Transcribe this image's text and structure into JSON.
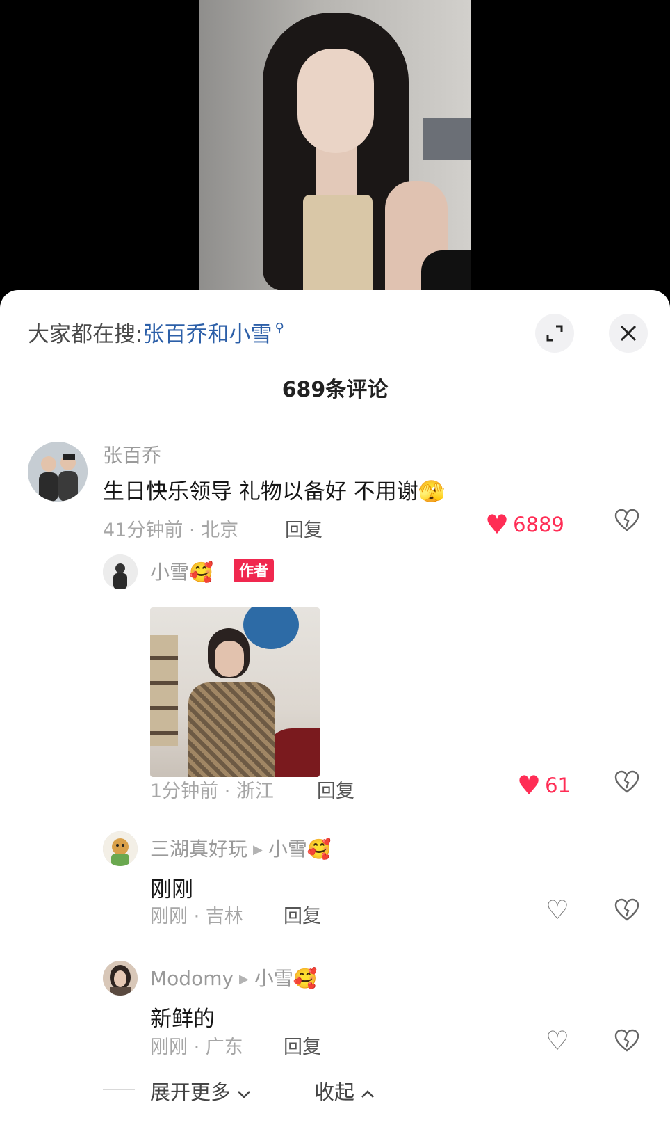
{
  "search_hint": {
    "prefix": "大家都在搜:",
    "term": "张百乔和小雪"
  },
  "comment_count": "689条评论",
  "comments": [
    {
      "username": "张百乔",
      "text": "生日快乐领导 礼物以备好 不用谢🫣",
      "time_location": "41分钟前 · 北京",
      "reply_label": "回复",
      "likes": "6889",
      "replies": [
        {
          "username": "小雪🥰",
          "badge": "作者",
          "time_location": "1分钟前 · 浙江",
          "reply_label": "回复",
          "likes": "61"
        },
        {
          "username": "三湖真好玩",
          "reply_to": "小雪🥰",
          "text": "刚刚",
          "time_location": "刚刚 · 吉林",
          "reply_label": "回复"
        },
        {
          "username": "Modomy",
          "reply_to": "小雪🥰",
          "text": "新鲜的",
          "time_location": "刚刚 · 广东",
          "reply_label": "回复"
        }
      ]
    }
  ],
  "footer": {
    "expand_more": "展开更多",
    "collapse": "收起"
  },
  "colors": {
    "accent": "#ff2d55",
    "link": "#2c5fa8",
    "author_badge": "#f0284f"
  },
  "icons": [
    "expand-icon",
    "close-icon",
    "search-icon",
    "heart-icon",
    "dislike-icon",
    "chevron-down-icon",
    "chevron-up-icon"
  ]
}
